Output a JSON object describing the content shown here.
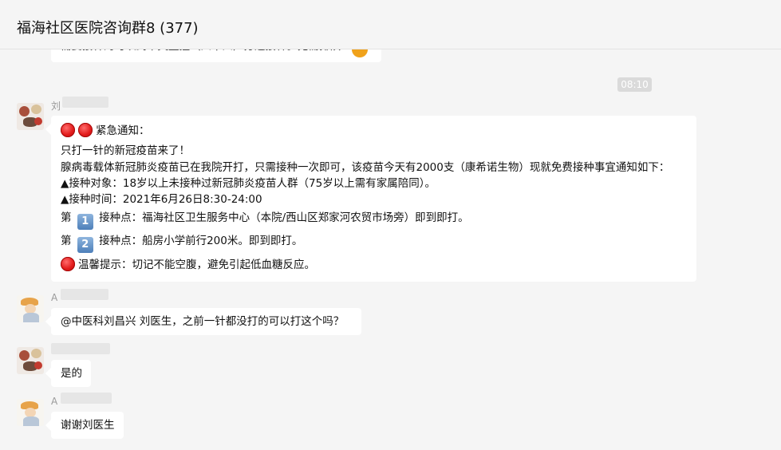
{
  "header": {
    "title": "福海社区医院咨询群8 (377)"
  },
  "previous_message": {
    "text": "需要接种的可以到中央监控（四十四）分遮接种。无需排队"
  },
  "timestamp": "08:10",
  "messages": [
    {
      "sender_initial": "刘",
      "avatar": "doctor-avatar",
      "lines": {
        "l1_label": "紧急通知：",
        "l2": "只打一针的新冠疫苗来了！",
        "l3": "腺病毒载体新冠肺炎疫苗已在我院开打，只需接种一次即可，该疫苗今天有2000支（康希诺生物）现就免费接种事宜通知如下：",
        "l4": "▲接种对象：18岁以上未接种过新冠肺炎疫苗人群（75岁以上需有家属陪同）。",
        "l5": "▲接种时间：2021年6月26日8:30-24:00",
        "l6_prefix": "第",
        "l6_num": "1",
        "l6_text": "接种点：福海社区卫生服务中心（本院/西山区郑家河农贸市场旁）即到即打。",
        "l7_prefix": "第",
        "l7_num": "2",
        "l7_text": "接种点：船房小学前行200米。即到即打。",
        "l8": "温馨提示：切记不能空腹，避免引起低血糖反应。"
      }
    },
    {
      "sender_initial": "A",
      "avatar": "farmer-avatar",
      "text": "@中医科刘昌兴 刘医生，之前一针都没打的可以打这个吗？"
    },
    {
      "sender_initial": "",
      "avatar": "doctor-avatar",
      "text": "是的"
    },
    {
      "sender_initial": "A",
      "avatar": "farmer-avatar",
      "text": "谢谢刘医生"
    }
  ]
}
